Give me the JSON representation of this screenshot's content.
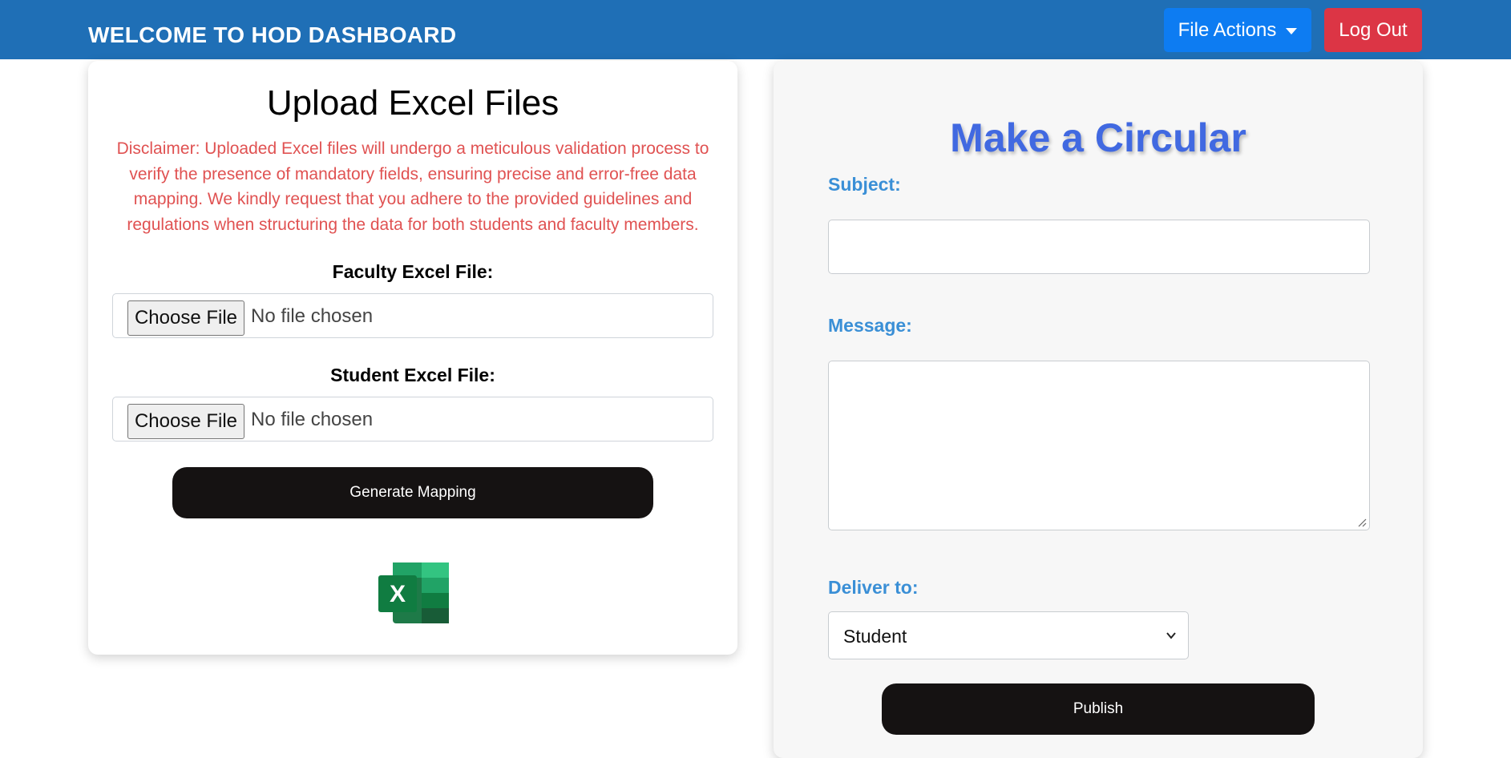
{
  "header": {
    "title": "WELCOME TO HOD DASHBOARD",
    "file_actions_label": "File Actions",
    "logout_label": "Log Out",
    "colors": {
      "bar": "#1f6fb6",
      "file_actions": "#0d7cf2",
      "logout": "#dc3545"
    }
  },
  "upload": {
    "title": "Upload Excel Files",
    "disclaimer": "Disclaimer: Uploaded Excel files will undergo a meticulous validation process to verify the presence of mandatory fields, ensuring precise and error-free data mapping. We kindly request that you adhere to the provided guidelines and regulations when structuring the data for both students and faculty members.",
    "faculty_label": "Faculty Excel File:",
    "student_label": "Student Excel File:",
    "choose_file_label": "Choose File",
    "no_file_text": "No file chosen",
    "generate_label": "Generate Mapping",
    "icon": "excel-icon"
  },
  "circular": {
    "title": "Make a Circular",
    "subject_label": "Subject:",
    "subject_value": "",
    "message_label": "Message:",
    "message_value": "",
    "deliver_label": "Deliver to:",
    "deliver_selected": "Student",
    "publish_label": "Publish",
    "colors": {
      "title": "#4169e1",
      "labels": "#3a8fd6",
      "disclaimer": "#e05252"
    }
  }
}
